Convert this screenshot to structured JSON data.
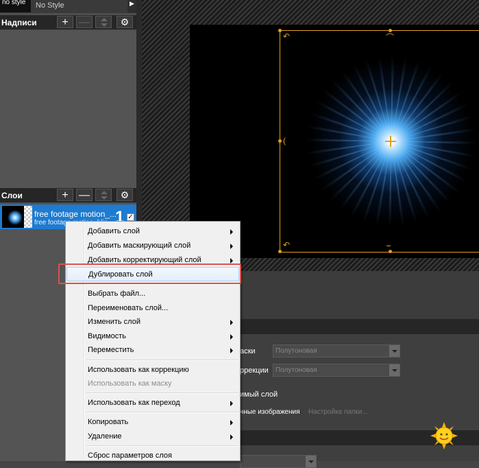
{
  "style_panel": {
    "thumb_label": "no style",
    "name": "No Style"
  },
  "captions_panel": {
    "title": "Надписи",
    "add": "+",
    "remove": "—"
  },
  "layers_panel": {
    "title": "Слои",
    "add": "+",
    "remove": "—",
    "layer": {
      "name": "free footage motion_...",
      "subname": "free footage motion_blin",
      "number": "1",
      "checked": "✓"
    }
  },
  "properties": {
    "label_mask": "аски",
    "mask_dropdown": "Полутоновая",
    "label_correction": "ррекции",
    "correction_dropdown": "Полутоновая",
    "visible_layer": "имый слой",
    "images_label": "чные изображения",
    "folder_settings": "Настройка папки..."
  },
  "context_menu": {
    "items": [
      {
        "label": "Добавить слой",
        "submenu": true,
        "disabled": false
      },
      {
        "label": "Добавить маскирующий слой",
        "submenu": true,
        "disabled": false
      },
      {
        "label": "Добавить корректирующий слой",
        "submenu": true,
        "disabled": false
      },
      {
        "label": "Дублировать слой",
        "submenu": false,
        "disabled": false,
        "highlighted": true
      },
      {
        "label": "Выбрать файл...",
        "submenu": false,
        "disabled": false
      },
      {
        "label": "Переименовать слой...",
        "submenu": false,
        "disabled": false
      },
      {
        "label": "Изменить слой",
        "submenu": true,
        "disabled": false
      },
      {
        "label": "Видимость",
        "submenu": true,
        "disabled": false
      },
      {
        "label": "Переместить",
        "submenu": true,
        "disabled": false
      },
      {
        "label": "Использовать как коррекцию",
        "submenu": false,
        "disabled": false
      },
      {
        "label": "Использовать как маску",
        "submenu": false,
        "disabled": true
      },
      {
        "label": "Использовать как переход",
        "submenu": true,
        "disabled": false
      },
      {
        "label": "Копировать",
        "submenu": true,
        "disabled": false
      },
      {
        "label": "Удаление",
        "submenu": true,
        "disabled": false
      },
      {
        "label": "Сброс параметров слоя",
        "submenu": false,
        "disabled": false
      }
    ]
  },
  "colors": {
    "accent_orange": "#e0a020",
    "selection_blue": "#1e7bd0",
    "highlight_red": "#d9534f"
  },
  "icons": [
    "gear-icon",
    "plus-icon",
    "minus-icon",
    "spinner-icon",
    "submenu-arrow-icon",
    "sun-emoticon-icon",
    "crosshair-icon"
  ]
}
